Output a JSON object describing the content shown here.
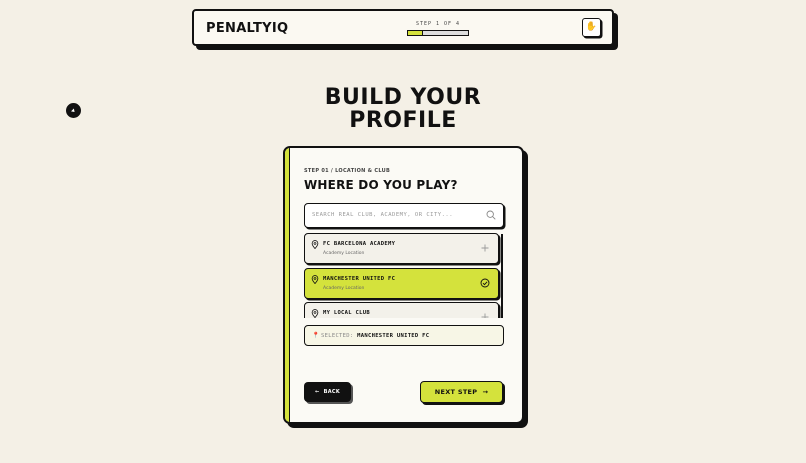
{
  "header": {
    "brand": "PENALTYIQ",
    "step_label": "STEP 1 OF 4",
    "progress_fraction": 0.25,
    "lang_icon": "hand-icon"
  },
  "page": {
    "title_line1": "BUILD YOUR",
    "title_line2": "PROFILE"
  },
  "card": {
    "step_caption": "STEP 01 / LOCATION & CLUB",
    "section_title": "WHERE DO YOU PLAY?",
    "search": {
      "placeholder": "SEARCH REAL CLUB, ACADEMY, OR CITY...",
      "value": ""
    },
    "items": [
      {
        "name": "FC BARCELONA ACADEMY",
        "sub": "Academy Location",
        "selected": false
      },
      {
        "name": "MANCHESTER UNITED FC",
        "sub": "Academy Location",
        "selected": true
      },
      {
        "name": "MY LOCAL CLUB",
        "sub": "",
        "selected": false
      }
    ],
    "selected_label": "SELECTED:",
    "selected_value": "MANCHESTER UNITED FC",
    "back_label": "BACK",
    "next_label": "NEXT STEP"
  },
  "colors": {
    "accent": "#d4e23c",
    "background": "#f4f0e6",
    "ink": "#111111",
    "pin_red": "#e23b2e"
  }
}
